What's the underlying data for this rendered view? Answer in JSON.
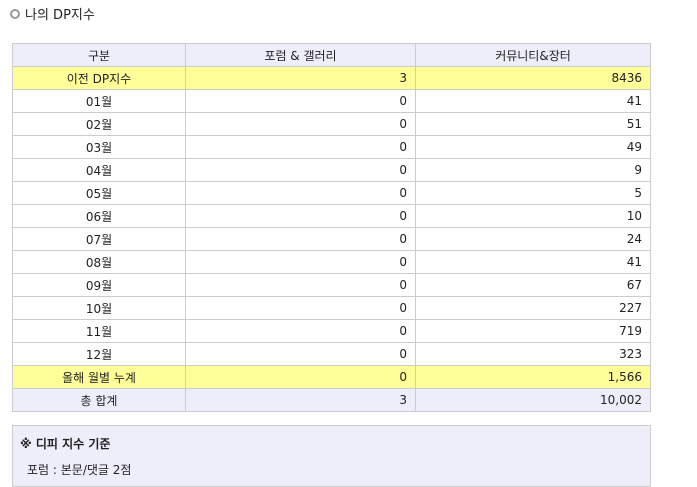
{
  "title": "나의 DP지수",
  "headers": [
    "구분",
    "포럼 & 갤러리",
    "커뮤니티&장터"
  ],
  "previous": {
    "label": "이전 DP지수",
    "forum": "3",
    "community": "8436"
  },
  "months": [
    {
      "label": "01월",
      "forum": "0",
      "community": "41"
    },
    {
      "label": "02월",
      "forum": "0",
      "community": "51"
    },
    {
      "label": "03월",
      "forum": "0",
      "community": "49"
    },
    {
      "label": "04월",
      "forum": "0",
      "community": "9"
    },
    {
      "label": "05월",
      "forum": "0",
      "community": "5"
    },
    {
      "label": "06월",
      "forum": "0",
      "community": "10"
    },
    {
      "label": "07월",
      "forum": "0",
      "community": "24"
    },
    {
      "label": "08월",
      "forum": "0",
      "community": "41"
    },
    {
      "label": "09월",
      "forum": "0",
      "community": "67"
    },
    {
      "label": "10월",
      "forum": "0",
      "community": "227"
    },
    {
      "label": "11월",
      "forum": "0",
      "community": "719"
    },
    {
      "label": "12월",
      "forum": "0",
      "community": "323"
    }
  ],
  "year_sum": {
    "label": "올해 월별 누계",
    "forum": "0",
    "community": "1,566"
  },
  "total": {
    "label": "총 합계",
    "forum": "3",
    "community": "10,002"
  },
  "note": {
    "heading": "※ 디피 지수 기준",
    "line1": "포럼 : 본문/댓글 2점"
  }
}
